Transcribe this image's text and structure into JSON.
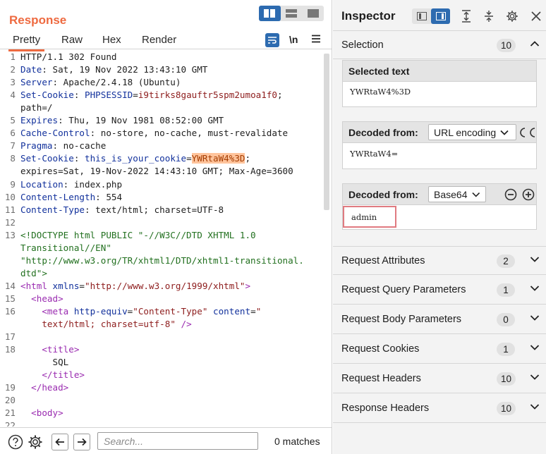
{
  "response": {
    "title": "Response",
    "tabs": [
      {
        "label": "Pretty"
      },
      {
        "label": "Raw"
      },
      {
        "label": "Hex"
      },
      {
        "label": "Render"
      }
    ],
    "newline_toggle": "\\n",
    "lines": [
      {
        "n": "1",
        "parts": [
          {
            "t": "HTTP/1.1 302 Found",
            "c": ""
          }
        ]
      },
      {
        "n": "2",
        "parts": [
          {
            "t": "Date",
            "c": "k"
          },
          {
            "t": ": Sat, 19 Nov 2022 13:43:10 GMT",
            "c": ""
          }
        ]
      },
      {
        "n": "3",
        "parts": [
          {
            "t": "Server",
            "c": "k"
          },
          {
            "t": ": Apache/2.4.18 (Ubuntu)",
            "c": ""
          }
        ]
      },
      {
        "n": "4",
        "parts": [
          {
            "t": "Set-Cookie",
            "c": "k"
          },
          {
            "t": ": ",
            "c": ""
          },
          {
            "t": "PHPSESSID",
            "c": "k"
          },
          {
            "t": "=",
            "c": ""
          },
          {
            "t": "i9tirks8gauftr5spm2umoa1f0",
            "c": "str"
          },
          {
            "t": ";",
            "c": ""
          }
        ]
      },
      {
        "n": "",
        "parts": [
          {
            "t": "path=/",
            "c": ""
          }
        ]
      },
      {
        "n": "5",
        "parts": [
          {
            "t": "Expires",
            "c": "k"
          },
          {
            "t": ": Thu, 19 Nov 1981 08:52:00 GMT",
            "c": ""
          }
        ]
      },
      {
        "n": "6",
        "parts": [
          {
            "t": "Cache-Control",
            "c": "k"
          },
          {
            "t": ": no-store, no-cache, must-revalidate",
            "c": ""
          }
        ]
      },
      {
        "n": "7",
        "parts": [
          {
            "t": "Pragma",
            "c": "k"
          },
          {
            "t": ": no-cache",
            "c": ""
          }
        ]
      },
      {
        "n": "8",
        "parts": [
          {
            "t": "Set-Cookie",
            "c": "k"
          },
          {
            "t": ": ",
            "c": ""
          },
          {
            "t": "this_is_your_cookie",
            "c": "k"
          },
          {
            "t": "=",
            "c": ""
          },
          {
            "t": "YWRtaW4%3D",
            "c": "hl"
          },
          {
            "t": ";",
            "c": ""
          }
        ]
      },
      {
        "n": "",
        "parts": [
          {
            "t": "expires=Sat, 19-Nov-2022 14:43:10 GMT; Max-Age=3600",
            "c": ""
          }
        ]
      },
      {
        "n": "9",
        "parts": [
          {
            "t": "Location",
            "c": "k"
          },
          {
            "t": ": index.php",
            "c": ""
          }
        ]
      },
      {
        "n": "10",
        "parts": [
          {
            "t": "Content-Length",
            "c": "k"
          },
          {
            "t": ": 554",
            "c": ""
          }
        ]
      },
      {
        "n": "11",
        "parts": [
          {
            "t": "Content-Type",
            "c": "k"
          },
          {
            "t": ": text/html; charset=UTF-8",
            "c": ""
          }
        ]
      },
      {
        "n": "12",
        "parts": []
      },
      {
        "n": "13",
        "parts": [
          {
            "t": "<!DOCTYPE html PUBLIC \"-//W3C//DTD XHTML 1.0",
            "c": "dt"
          }
        ]
      },
      {
        "n": "",
        "parts": [
          {
            "t": "Transitional//EN\"",
            "c": "dt"
          }
        ]
      },
      {
        "n": "",
        "parts": [
          {
            "t": "\"http://www.w3.org/TR/xhtml1/DTD/xhtml1-transitional.",
            "c": "dt"
          }
        ]
      },
      {
        "n": "",
        "parts": [
          {
            "t": "dtd\">",
            "c": "dt"
          }
        ]
      },
      {
        "n": "14",
        "parts": [
          {
            "t": "<html ",
            "c": "tag"
          },
          {
            "t": "xmlns",
            "c": "attr"
          },
          {
            "t": "=",
            "c": ""
          },
          {
            "t": "\"http://www.w3.org/1999/xhtml\"",
            "c": "str"
          },
          {
            "t": ">",
            "c": "tag"
          }
        ]
      },
      {
        "n": "15",
        "parts": [
          {
            "t": "  ",
            "c": ""
          },
          {
            "t": "<head>",
            "c": "tag"
          }
        ]
      },
      {
        "n": "16",
        "parts": [
          {
            "t": "    ",
            "c": ""
          },
          {
            "t": "<meta ",
            "c": "tag"
          },
          {
            "t": "http-equiv",
            "c": "attr"
          },
          {
            "t": "=",
            "c": ""
          },
          {
            "t": "\"Content-Type\"",
            "c": "str"
          },
          {
            "t": " ",
            "c": ""
          },
          {
            "t": "content",
            "c": "attr"
          },
          {
            "t": "=",
            "c": ""
          },
          {
            "t": "\"",
            "c": "str"
          }
        ]
      },
      {
        "n": "",
        "parts": [
          {
            "t": "    ",
            "c": ""
          },
          {
            "t": "text/html; charset=utf-8\"",
            "c": "str"
          },
          {
            "t": " />",
            "c": "tag"
          }
        ]
      },
      {
        "n": "17",
        "parts": []
      },
      {
        "n": "18",
        "parts": [
          {
            "t": "    ",
            "c": ""
          },
          {
            "t": "<title>",
            "c": "tag"
          }
        ]
      },
      {
        "n": "",
        "parts": [
          {
            "t": "      SQL",
            "c": ""
          }
        ]
      },
      {
        "n": "",
        "parts": [
          {
            "t": "    ",
            "c": ""
          },
          {
            "t": "</title>",
            "c": "tag"
          }
        ]
      },
      {
        "n": "19",
        "parts": [
          {
            "t": "  ",
            "c": ""
          },
          {
            "t": "</head>",
            "c": "tag"
          }
        ]
      },
      {
        "n": "20",
        "parts": []
      },
      {
        "n": "21",
        "parts": [
          {
            "t": "  ",
            "c": ""
          },
          {
            "t": "<body>",
            "c": "tag"
          }
        ]
      },
      {
        "n": "22",
        "parts": []
      }
    ],
    "search_placeholder": "Search...",
    "matches": "0 matches"
  },
  "inspector": {
    "title": "Inspector",
    "selection": {
      "label": "Selection",
      "count": "10"
    },
    "selected_text": {
      "label": "Selected text",
      "value": "YWRtaW4%3D"
    },
    "decoded1": {
      "label": "Decoded from:",
      "encoding": "URL encoding",
      "value": "YWRtaW4="
    },
    "decoded2": {
      "label": "Decoded from:",
      "encoding": "Base64",
      "value": "admin"
    },
    "sections": [
      {
        "label": "Request Attributes",
        "count": "2"
      },
      {
        "label": "Request Query Parameters",
        "count": "1"
      },
      {
        "label": "Request Body Parameters",
        "count": "0"
      },
      {
        "label": "Request Cookies",
        "count": "1"
      },
      {
        "label": "Request Headers",
        "count": "10"
      },
      {
        "label": "Response Headers",
        "count": "10"
      }
    ]
  },
  "colors": {
    "accent": "#ee6a40",
    "active_blue": "#2d6bb0",
    "highlight": "#ffc49c",
    "admin_box": "#e07a80"
  }
}
